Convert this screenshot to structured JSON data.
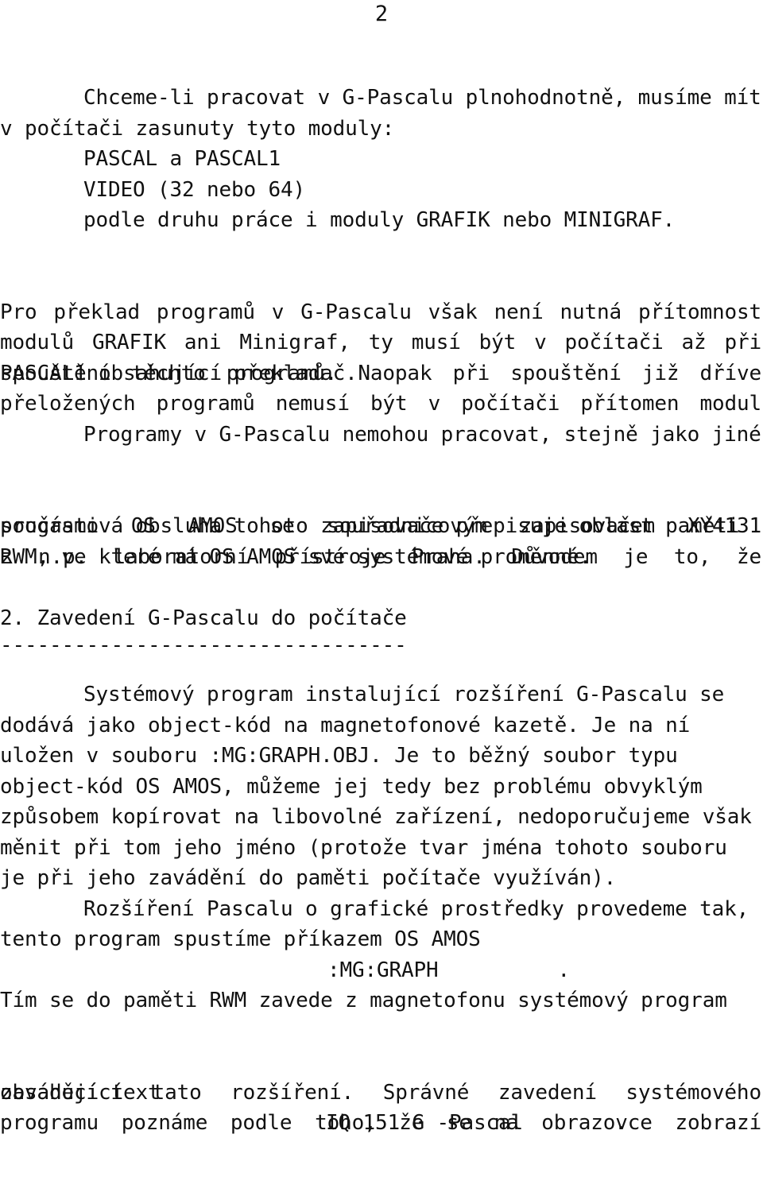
{
  "document": {
    "language": "cs",
    "page_number": "2",
    "background_color": "#ffffff",
    "text_color": "#111111"
  },
  "paragraphs": {
    "p1": {
      "lines": [
        "Chceme-li pracovat v G-Pascalu plnohodnotně, musíme mít",
        "v počítači zasunuty tyto moduly:"
      ]
    },
    "module_list": {
      "items": [
        "PASCAL a PASCAL1",
        "VIDEO (32 nebo 64)",
        "podle druhu práce i moduly GRAFIK nebo MINIGRAF."
      ]
    },
    "p2": {
      "lines": [
        "Pro překlad programů v G-Pascalu však není nutná přítomnost",
        "modulů GRAFIK ani Minigraf, ty musí být v počítači až při",
        "spouštění těchto programů. Naopak při spouštění již dříve",
        "přeložených programů nemusí být v počítači přítomen modul",
        "PASCAL1 obsahující překladač."
      ],
      "justified": [
        [
          [
            "Pro"
          ],
          [
            "překlad"
          ],
          [
            "programů"
          ],
          [
            "v"
          ],
          [
            "G-Pascalu"
          ],
          [
            "však"
          ],
          [
            "není"
          ],
          [
            "nutná"
          ],
          [
            "přítomnost"
          ]
        ],
        [
          [
            "modulů"
          ],
          [
            "GRAFIK"
          ],
          [
            "ani"
          ],
          [
            "Minigraf,"
          ],
          [
            "ty"
          ],
          [
            "musí"
          ],
          [
            "být"
          ],
          [
            "v"
          ],
          [
            "počítači"
          ],
          [
            "až"
          ],
          [
            "při"
          ]
        ],
        [
          [
            "spouštění"
          ],
          [
            "těchto"
          ],
          [
            "programů."
          ],
          [
            "Naopak"
          ],
          [
            "při"
          ],
          [
            "spouštění"
          ],
          [
            "již"
          ],
          [
            "dříve"
          ]
        ],
        [
          [
            "přeložených"
          ],
          [
            "programů"
          ],
          [
            "nemusí"
          ],
          [
            "být"
          ],
          [
            "v"
          ],
          [
            "počítači"
          ],
          [
            "přítomen"
          ],
          [
            "modul"
          ]
        ]
      ],
      "last_line": "PASCAL1 obsahující překladač."
    },
    "p3": {
      "line1_indented": "Programy v G-Pascalu nemohou pracovat, stejně jako jiné",
      "line2_words": [
        "součásti",
        "OS",
        "AMOS",
        "se",
        "souřadnicovým",
        "zapisovačem",
        "XY4131"
      ],
      "line3_words": [
        "z",
        "n.p.",
        "laboratorní",
        "přístroje",
        "Praha.",
        "Důvodem",
        "je",
        "to,",
        "že"
      ],
      "line4": "programová obsluha tohoto zapisovače přepisuje oblast paměti",
      "line5": "RWM, ve které má OS AMOS své systémové proměnné."
    }
  },
  "section": {
    "heading": "2. Zavedení G-Pascalu do počítače",
    "underline": "---------------------------------"
  },
  "paragraphs2": {
    "p4": {
      "line1_indented": "Systémový program instalující rozšíření G-Pascalu se",
      "line2": "dodává jako object-kód na magnetofonové kazetě. Je na ní",
      "line3": "uložen v souboru :MG:GRAPH.OBJ. Je to běžný soubor typu",
      "line4": "object-kód OS AMOS, můžeme jej tedy bez problému obvyklým",
      "line5": "způsobem kopírovat na libovolné zařízení, nedoporučujeme však",
      "line6": "měnit při tom jeho jméno (protože tvar jména tohoto souboru",
      "line7": "je při jeho zavádění do paměti počítače využíván)."
    },
    "p5": {
      "line1_indented": "Rozšíření Pascalu o grafické prostředky provedeme tak,",
      "line2": "tento program spustíme příkazem OS AMOS"
    },
    "command_line": {
      "command": ":MG:GRAPH",
      "terminator": "."
    },
    "p6": {
      "line1": "Tím se do paměti RWM zavede z magnetofonu systémový program",
      "line2_words": [
        "obsahující",
        "tato",
        "rozšíření.",
        "Správné",
        "zavedení",
        "systémového"
      ],
      "line3_words": [
        "programu",
        "poznáme",
        "podle",
        "toho,",
        "že",
        "se",
        "na",
        "obrazovce",
        "zobrazí"
      ],
      "line4": "zaváděcí text"
    },
    "boot_text_line": {
      "text": "IQ 151 G -Pascal",
      "terminator": "."
    }
  }
}
